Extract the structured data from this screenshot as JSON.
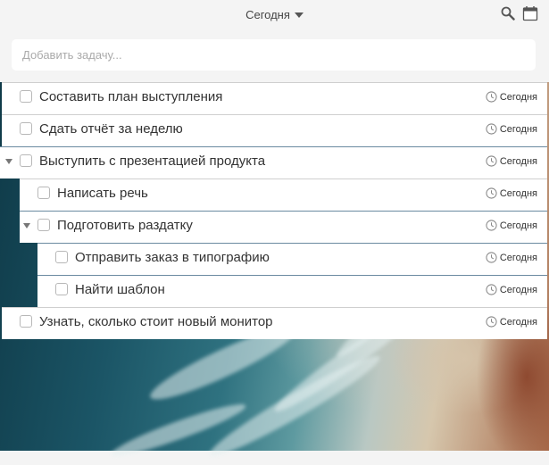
{
  "header": {
    "title": "Сегодня"
  },
  "add_task": {
    "placeholder": "Добавить задачу..."
  },
  "tasks": [
    {
      "label": "Составить план выступления",
      "due": "Сегодня",
      "level": 0,
      "expandable": false
    },
    {
      "label": "Сдать отчёт за неделю",
      "due": "Сегодня",
      "level": 0,
      "expandable": false
    },
    {
      "label": "Выступить с презентацией продукта",
      "due": "Сегодня",
      "level": 0,
      "expandable": true
    },
    {
      "label": "Написать речь",
      "due": "Сегодня",
      "level": 1,
      "expandable": false
    },
    {
      "label": "Подготовить раздатку",
      "due": "Сегодня",
      "level": 1,
      "expandable": true
    },
    {
      "label": "Отправить заказ в типографию",
      "due": "Сегодня",
      "level": 2,
      "expandable": false
    },
    {
      "label": "Найти шаблон",
      "due": "Сегодня",
      "level": 2,
      "expandable": false
    },
    {
      "label": "Узнать, сколько стоит новый монитор",
      "due": "Сегодня",
      "level": 0,
      "expandable": false
    }
  ]
}
